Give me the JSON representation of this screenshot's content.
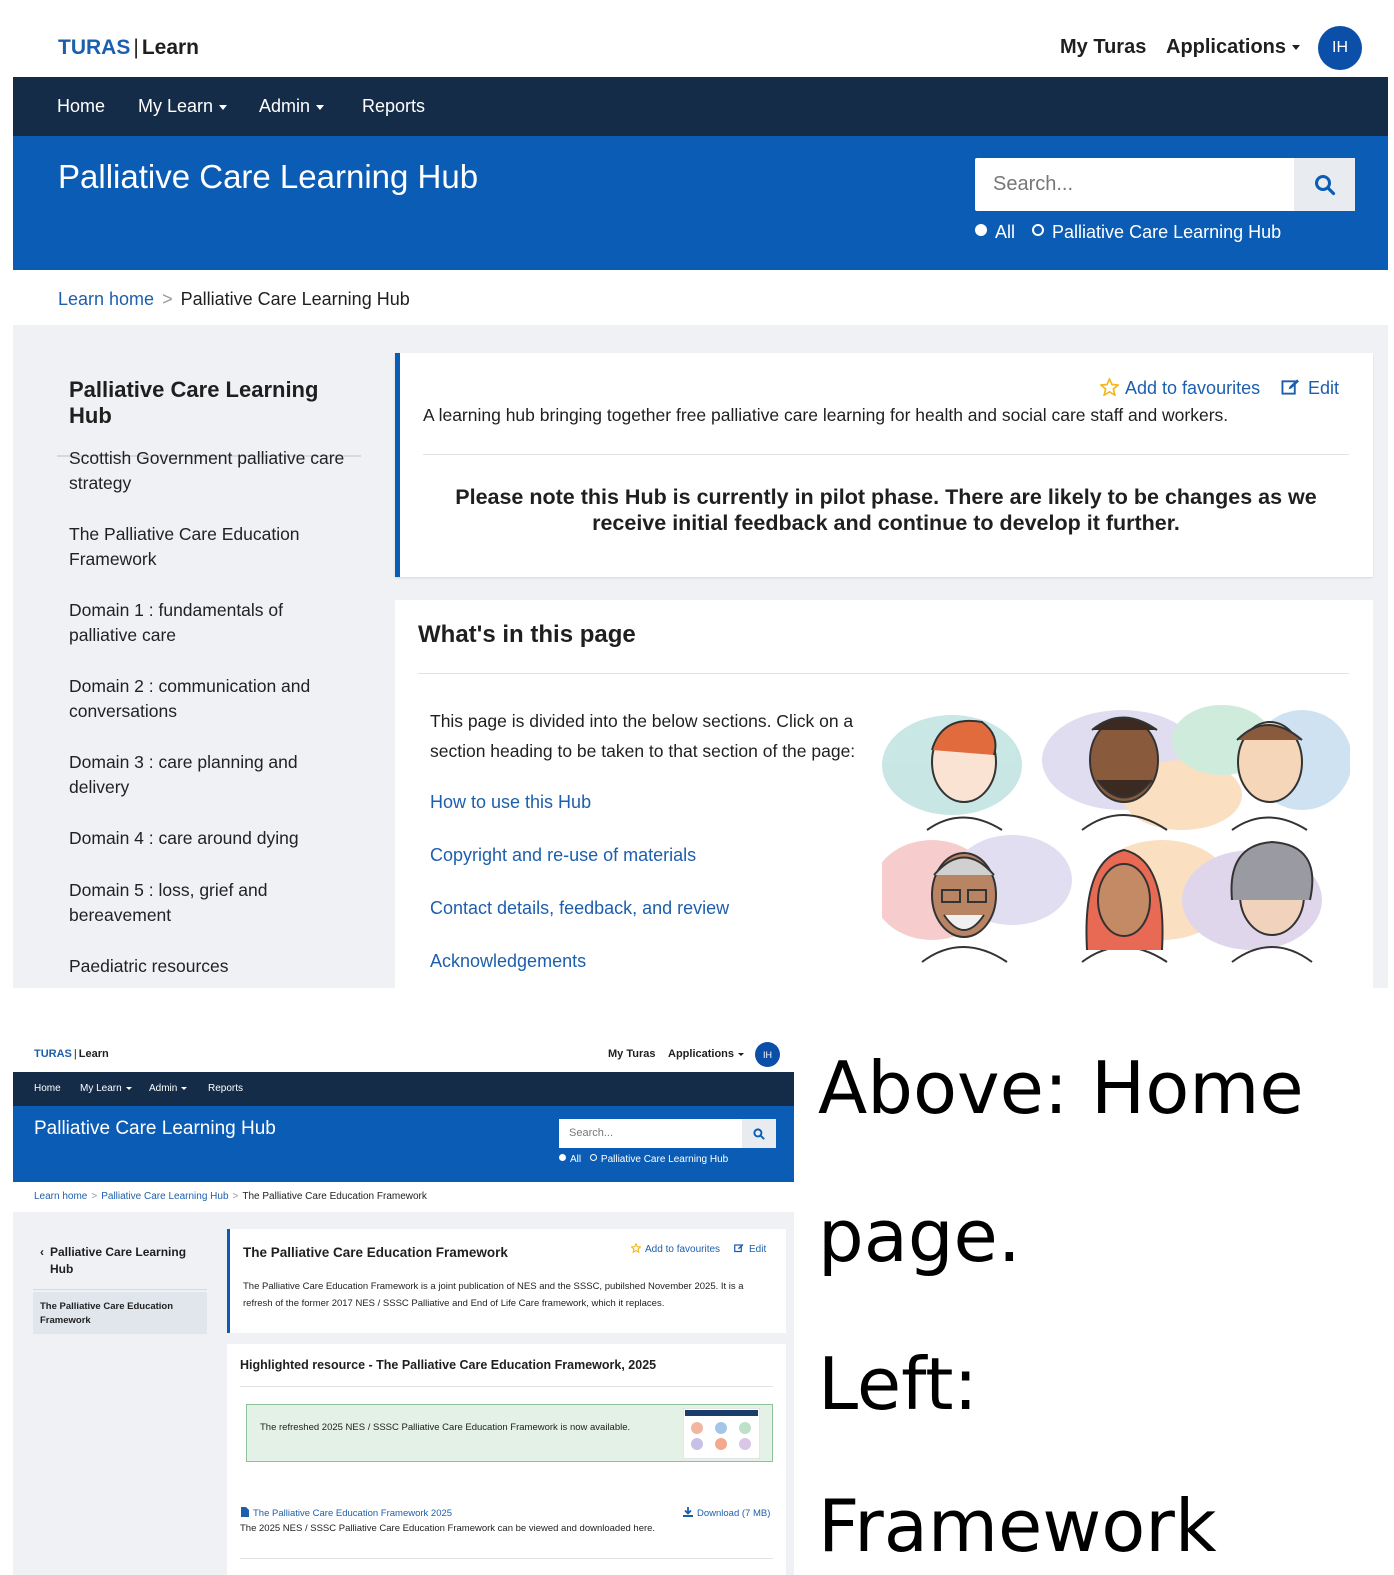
{
  "home": {
    "brand": {
      "logo_turas": "TURAS",
      "logo_learn": "Learn"
    },
    "topbar": {
      "my_turas": "My Turas",
      "applications": "Applications",
      "avatar": "IH"
    },
    "nav": [
      "Home",
      "My Learn",
      "Admin",
      "Reports"
    ],
    "hero": {
      "title": "Palliative Care Learning Hub",
      "search_placeholder": "Search...",
      "radio_all": "All",
      "radio_hub": "Palliative Care Learning Hub"
    },
    "breadcrumb": {
      "home": "Learn home",
      "current": "Palliative Care Learning Hub"
    },
    "sidebar": {
      "title": "Palliative Care Learning Hub",
      "items": [
        "Scottish Government palliative care strategy",
        "The Palliative Care Education Framework",
        "Domain 1 : fundamentals of palliative care",
        "Domain 2 : communication and conversations",
        "Domain 3 : care planning and delivery",
        "Domain 4 : care around dying",
        "Domain 5 : loss, grief and bereavement",
        "Paediatric resources"
      ]
    },
    "intro_card": {
      "add_favourites": "Add to favourites",
      "edit": "Edit",
      "description": "A learning hub bringing together free palliative care learning for health and social care staff and workers.",
      "note": "Please note this Hub is currently in pilot phase.  There are likely to be changes as we receive initial feedback and continue to develop it further."
    },
    "contents_card": {
      "title": "What's in this page",
      "intro": "This page is divided into the below sections.  Click on a section heading to be taken to that section of the page:",
      "links": [
        "How to use this Hub",
        "Copyright and re-use of materials",
        "Contact details, feedback, and review",
        "Acknowledgements"
      ]
    }
  },
  "framework": {
    "brand": {
      "logo_turas": "TURAS",
      "logo_learn": "Learn"
    },
    "topbar": {
      "my_turas": "My Turas",
      "applications": "Applications",
      "avatar": "IH"
    },
    "nav": [
      "Home",
      "My Learn",
      "Admin",
      "Reports"
    ],
    "hero": {
      "title": "Palliative Care Learning Hub",
      "search_placeholder": "Search...",
      "radio_all": "All",
      "radio_hub": "Palliative Care Learning Hub"
    },
    "breadcrumb": {
      "home": "Learn home",
      "hub": "Palliative Care Learning Hub",
      "current": "The Palliative Care Education Framework"
    },
    "sidebar": {
      "back": "Palliative Care Learning Hub",
      "active": "The Palliative Care Education Framework"
    },
    "card": {
      "title": "The Palliative Care Education Framework",
      "add_favourites": "Add to favourites",
      "edit": "Edit",
      "description": "The Palliative Care Education Framework is a joint publication of NES and the SSSC, pubilshed November 2025. It is a refresh of the former 2017 NES / SSSC Palliative and End of Life Care framework, which it replaces."
    },
    "highlight": {
      "title": "Highlighted resource - The Palliative Care Education Framework, 2025",
      "alert": "The refreshed 2025 NES / SSSC Palliative Care Education Framework is now available.",
      "resource_link": "The Palliative Care Education Framework 2025",
      "download": "Download (7 MB)",
      "resource_desc": "The 2025 NES / SSSC Palliative Care Education Framework can be viewed and downloaded here."
    }
  },
  "caption": {
    "line1": "Above: Home",
    "line2": "page.",
    "line3": "Left:",
    "line4": "Framework"
  },
  "colors": {
    "brand_blue": "#0b5cb4",
    "nav_dark": "#142c48",
    "link_blue": "#1d5fad",
    "panel_grey": "#f0f1f5",
    "star": "#f2b91d"
  }
}
